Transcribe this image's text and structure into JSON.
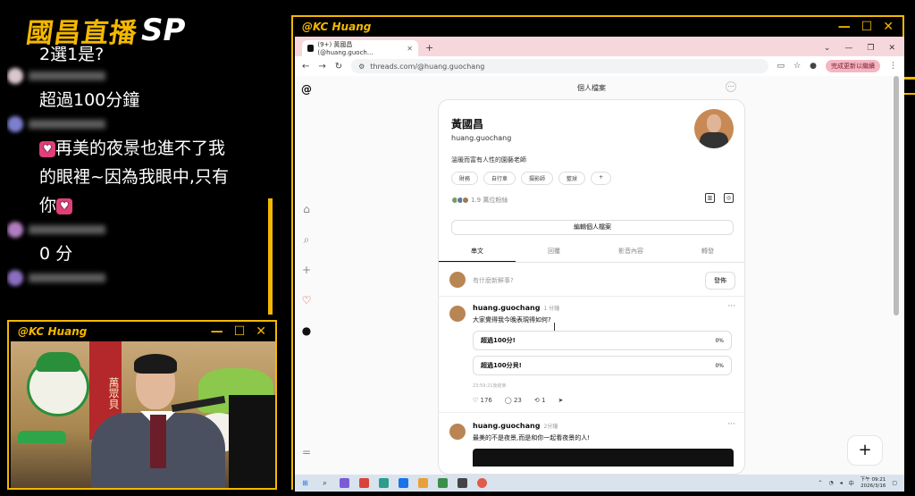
{
  "stream": {
    "logo_cn": "國昌直播",
    "logo_sp": "SP"
  },
  "chat": {
    "messages": [
      {
        "text": "2選1是?"
      },
      {
        "text": "超過100分鐘"
      },
      {
        "text": "再美的夜景也進不了我"
      },
      {
        "text": "的眼裡~因為我眼中,只有"
      },
      {
        "text": "你"
      },
      {
        "text": "0 分"
      }
    ]
  },
  "cam_window": {
    "title": "@KC Huang",
    "banner_text": "萬眾貝"
  },
  "main_window": {
    "title": "@KC Huang"
  },
  "browser": {
    "tab_title": "(9+) 黃國昌 (@huang.guoch...",
    "new_tab": "+",
    "address": "threads.com/@huang.guochang",
    "update_button": "完成更新以繼續"
  },
  "threads": {
    "header_title": "個人檔案",
    "profile": {
      "name": "黃國昌",
      "username": "huang.guochang",
      "bio": "溫暖而富有人性的園藝老師",
      "tags": [
        "財務",
        "自行車",
        "摄影師",
        "籃球",
        "+"
      ],
      "followers": "1.9 萬位粉絲",
      "edit_button": "編輯個人檔案"
    },
    "tabs": [
      "串文",
      "回覆",
      "影音內容",
      "轉發"
    ],
    "composer": {
      "placeholder": "有什麼新鮮事?",
      "post_button": "發佈"
    },
    "posts": [
      {
        "user": "huang.guochang",
        "time": "1 分鐘",
        "text": "大家覺得我今晚表現得如何?",
        "poll": [
          {
            "label": "超過100分!",
            "pct": "0%"
          },
          {
            "label": "超過100分貝!",
            "pct": "0%"
          }
        ],
        "poll_meta": "23:59:21後結束",
        "likes": "176",
        "comments": "23",
        "reposts": "1"
      },
      {
        "user": "huang.guochang",
        "time": "2分鐘",
        "text": "最美的不是夜景,而是和你一起看夜景的人!"
      }
    ],
    "fab": "+"
  },
  "taskbar": {
    "lang": "中",
    "time": "下午 09:21",
    "date": "2026/3/16"
  }
}
